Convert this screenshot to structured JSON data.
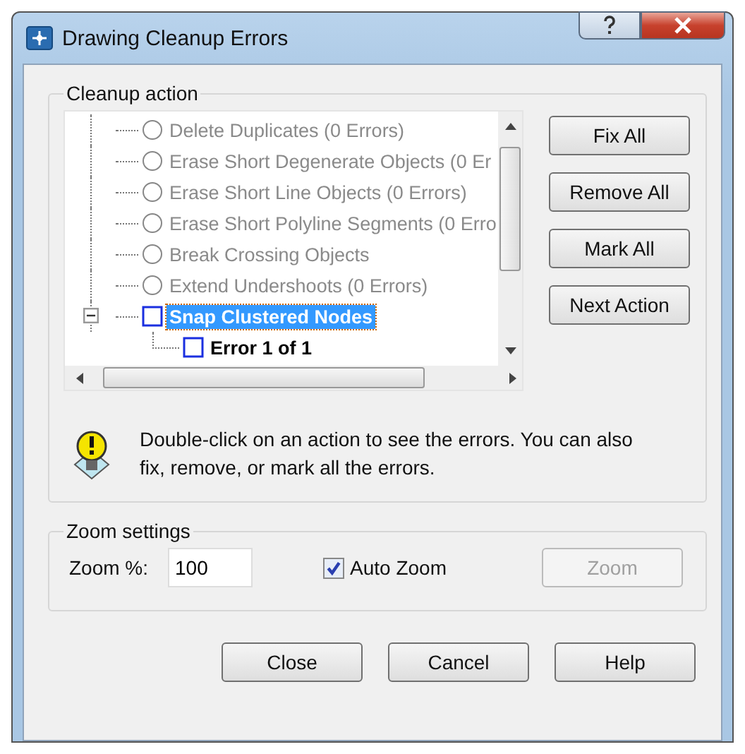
{
  "window": {
    "title": "Drawing Cleanup Errors"
  },
  "cleanup_action": {
    "title": "Cleanup action",
    "tree": [
      {
        "label": "Delete Duplicates (0 Errors)",
        "disabled": true,
        "selected": false
      },
      {
        "label": "Erase Short Degenerate Objects (0 Er",
        "disabled": true,
        "selected": false
      },
      {
        "label": "Erase Short Line Objects (0 Errors)",
        "disabled": true,
        "selected": false
      },
      {
        "label": "Erase Short Polyline Segments (0 Erro",
        "disabled": true,
        "selected": false
      },
      {
        "label": "Break Crossing Objects",
        "disabled": true,
        "selected": false
      },
      {
        "label": "Extend Undershoots (0 Errors)",
        "disabled": true,
        "selected": false
      },
      {
        "label": "Snap Clustered Nodes",
        "disabled": false,
        "selected": true,
        "expanded": true,
        "children": [
          {
            "label": "Error 1 of 1"
          }
        ]
      }
    ],
    "buttons": [
      "Fix All",
      "Remove All",
      "Mark All",
      "Next Action"
    ],
    "hint": "Double-click on an action to see the errors. You can also fix, remove, or mark all the errors."
  },
  "zoom_settings": {
    "title": "Zoom settings",
    "zoom_label": "Zoom %:",
    "zoom_value": "100",
    "auto_zoom": {
      "label": "Auto Zoom",
      "checked": true
    },
    "zoom_button": {
      "label": "Zoom",
      "disabled": true
    }
  },
  "buttons": [
    "Close",
    "Cancel",
    "Help"
  ]
}
